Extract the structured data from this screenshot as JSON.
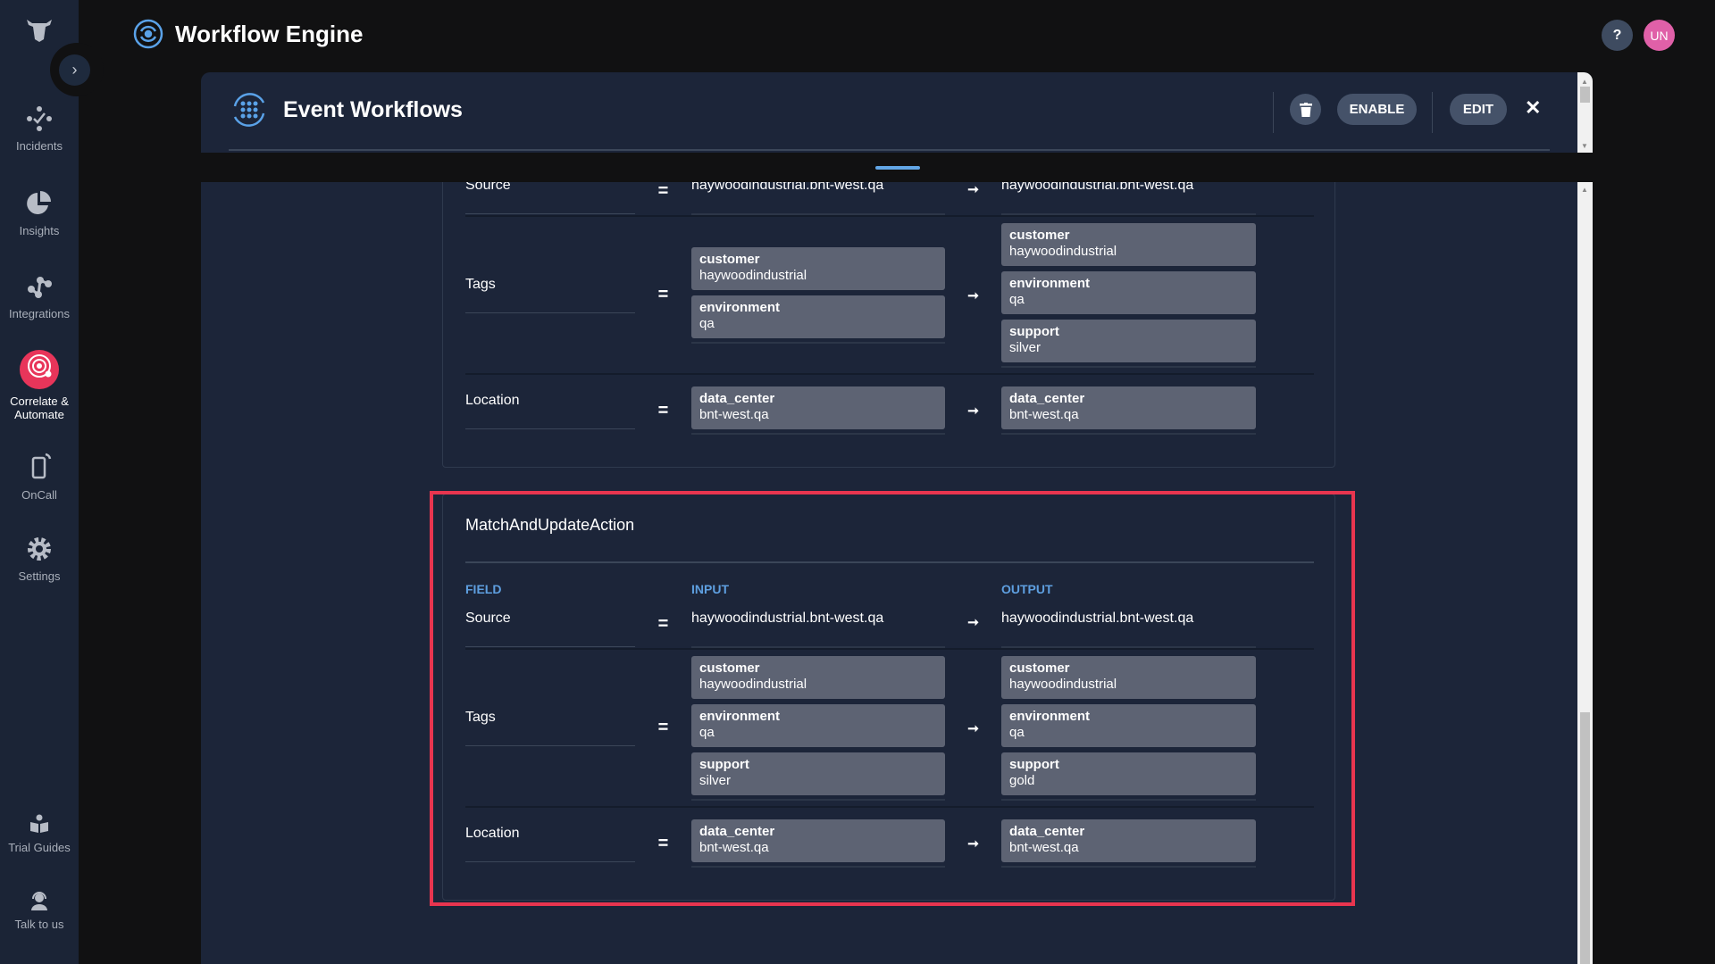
{
  "app": {
    "title": "Workflow Engine"
  },
  "sidebar": {
    "items": [
      {
        "label": "Incidents",
        "icon": "incidents-icon"
      },
      {
        "label": "Insights",
        "icon": "pie-chart-icon"
      },
      {
        "label": "Integrations",
        "icon": "integrations-icon"
      },
      {
        "label": "Correlate & Automate",
        "icon": "radar-icon",
        "active": true
      },
      {
        "label": "OnCall",
        "icon": "phone-icon"
      },
      {
        "label": "Settings",
        "icon": "gear-icon"
      },
      {
        "label": "Trial Guides",
        "icon": "book-icon"
      },
      {
        "label": "Talk to us",
        "icon": "headset-icon"
      }
    ]
  },
  "topbar": {
    "help": "?",
    "avatar": "UN",
    "avatar_color": "#e060a8"
  },
  "modal": {
    "title": "Event Workflows",
    "enable": "ENABLE",
    "edit": "EDIT",
    "close": "✕"
  },
  "columns": {
    "field": "FIELD",
    "input": "INPUT",
    "output": "OUTPUT"
  },
  "ops": {
    "eq": "=",
    "arrow": "➞"
  },
  "cards": [
    {
      "title": "",
      "rows": [
        {
          "field": "Source",
          "input": "haywoodindustrial.bnt-west.qa",
          "output": "haywoodindustrial.bnt-west.qa"
        },
        {
          "field": "Tags",
          "input": [
            {
              "k": "customer",
              "v": "haywoodindustrial"
            },
            {
              "k": "environment",
              "v": "qa"
            }
          ],
          "output": [
            {
              "k": "customer",
              "v": "haywoodindustrial"
            },
            {
              "k": "environment",
              "v": "qa"
            },
            {
              "k": "support",
              "v": "silver"
            }
          ]
        },
        {
          "field": "Location",
          "input": [
            {
              "k": "data_center",
              "v": "bnt-west.qa"
            }
          ],
          "output": [
            {
              "k": "data_center",
              "v": "bnt-west.qa"
            }
          ]
        }
      ]
    },
    {
      "title": "MatchAndUpdateAction",
      "rows": [
        {
          "field": "Source",
          "input": "haywoodindustrial.bnt-west.qa",
          "output": "haywoodindustrial.bnt-west.qa"
        },
        {
          "field": "Tags",
          "input": [
            {
              "k": "customer",
              "v": "haywoodindustrial"
            },
            {
              "k": "environment",
              "v": "qa"
            },
            {
              "k": "support",
              "v": "silver"
            }
          ],
          "output": [
            {
              "k": "customer",
              "v": "haywoodindustrial"
            },
            {
              "k": "environment",
              "v": "qa"
            },
            {
              "k": "support",
              "v": "gold"
            }
          ]
        },
        {
          "field": "Location",
          "input": [
            {
              "k": "data_center",
              "v": "bnt-west.qa"
            }
          ],
          "output": [
            {
              "k": "data_center",
              "v": "bnt-west.qa"
            }
          ]
        }
      ]
    }
  ],
  "colors": {
    "accent": "#5e9fe0",
    "highlight": "#e8354f",
    "active_nav": "#e8355a"
  }
}
